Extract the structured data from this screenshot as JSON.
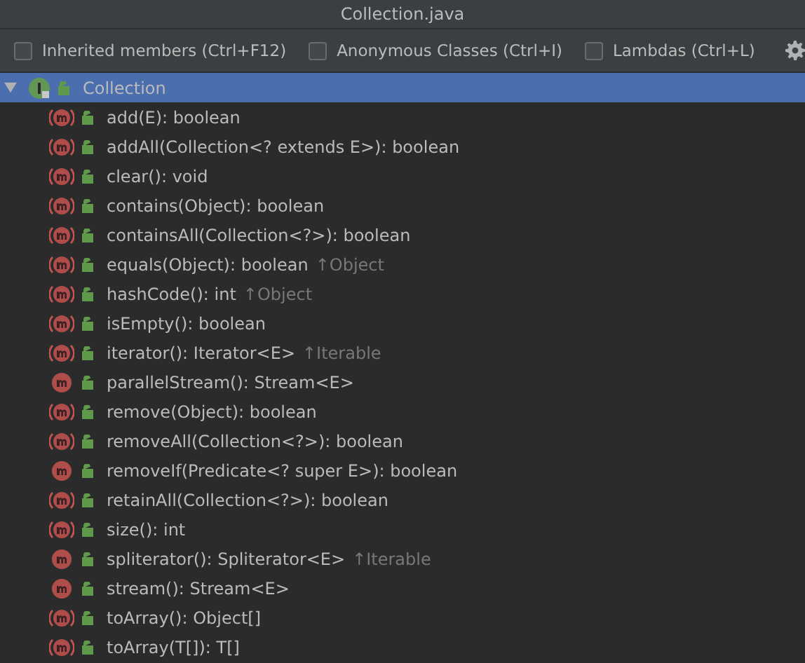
{
  "window": {
    "title": "Collection.java"
  },
  "options": [
    {
      "label": "Inherited members (Ctrl+F12)",
      "checked": false
    },
    {
      "label": "Anonymous Classes (Ctrl+I)",
      "checked": false
    },
    {
      "label": "Lambdas (Ctrl+L)",
      "checked": false
    }
  ],
  "tree": {
    "label": "Collection",
    "expanded": true,
    "selected": true,
    "children": [
      {
        "kind": "abstract",
        "label": "add(E): boolean",
        "selected": false
      },
      {
        "kind": "abstract",
        "label": "addAll(Collection<? extends E>): boolean",
        "selected": false
      },
      {
        "kind": "abstract",
        "label": "clear(): void",
        "selected": false
      },
      {
        "kind": "abstract",
        "label": "contains(Object): boolean",
        "selected": false
      },
      {
        "kind": "abstract",
        "label": "containsAll(Collection<?>): boolean",
        "selected": false
      },
      {
        "kind": "abstract",
        "label": "equals(Object): boolean",
        "inherited": "↑Object",
        "selected": false
      },
      {
        "kind": "abstract",
        "label": "hashCode(): int",
        "inherited": "↑Object",
        "selected": false
      },
      {
        "kind": "abstract",
        "label": "isEmpty(): boolean",
        "selected": false
      },
      {
        "kind": "abstract",
        "label": "iterator(): Iterator<E>",
        "inherited": "↑Iterable",
        "selected": false
      },
      {
        "kind": "default",
        "label": "parallelStream(): Stream<E>",
        "selected": false
      },
      {
        "kind": "abstract",
        "label": "remove(Object): boolean",
        "selected": false
      },
      {
        "kind": "abstract",
        "label": "removeAll(Collection<?>): boolean",
        "selected": false
      },
      {
        "kind": "default",
        "label": "removeIf(Predicate<? super E>): boolean",
        "selected": false
      },
      {
        "kind": "abstract",
        "label": "retainAll(Collection<?>): boolean",
        "selected": false
      },
      {
        "kind": "abstract",
        "label": "size(): int",
        "selected": false
      },
      {
        "kind": "default",
        "label": "spliterator(): Spliterator<E>",
        "inherited": "↑Iterable",
        "selected": false
      },
      {
        "kind": "default",
        "label": "stream(): Stream<E>",
        "selected": false
      },
      {
        "kind": "abstract",
        "label": "toArray(): Object[]",
        "selected": false
      },
      {
        "kind": "abstract",
        "label": "toArray(T[]): T[]",
        "selected": false
      }
    ]
  }
}
